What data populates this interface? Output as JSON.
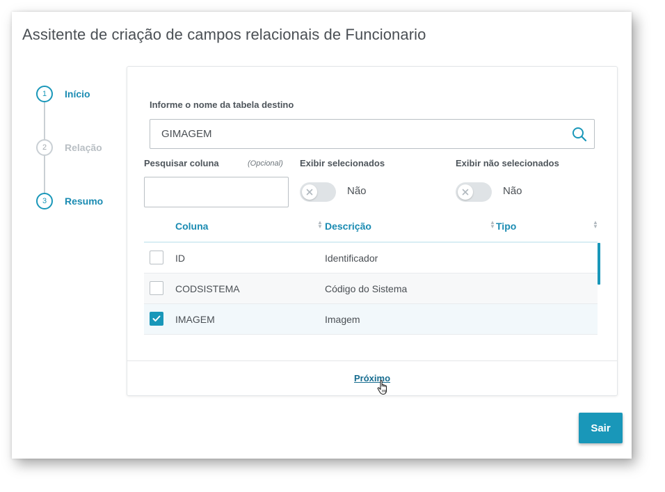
{
  "dialog": {
    "title": "Assitente de criação de campos relacionais de Funcionario"
  },
  "stepper": {
    "steps": [
      {
        "number": "1",
        "label": "Início",
        "active": true
      },
      {
        "number": "2",
        "label": "Relação",
        "active": false
      },
      {
        "number": "3",
        "label": "Resumo",
        "active": true
      }
    ]
  },
  "form": {
    "table_label": "Informe o nome da tabela destino",
    "table_value": "GIMAGEM",
    "column_search_label": "Pesquisar coluna",
    "column_search_optional": "(Opcional)",
    "column_search_value": "",
    "show_selected_label": "Exibir selecionados",
    "show_selected_value": "Não",
    "show_unselected_label": "Exibir não selecionados",
    "show_unselected_value": "Não"
  },
  "grid": {
    "headers": {
      "column": "Coluna",
      "description": "Descrição",
      "type": "Tipo"
    },
    "rows": [
      {
        "coluna": "ID",
        "descricao": "Identificador",
        "tipo": "",
        "checked": false
      },
      {
        "coluna": "CODSISTEMA",
        "descricao": "Código do Sistema",
        "tipo": "",
        "checked": false
      },
      {
        "coluna": "IMAGEM",
        "descricao": "Imagem",
        "tipo": "",
        "checked": true
      }
    ]
  },
  "footer": {
    "next_label": "Próximo",
    "exit_label": "Sair"
  },
  "colors": {
    "accent": "#1997b9",
    "link": "#166c8f",
    "text": "#4a4f54"
  },
  "icons": {
    "search": "search-icon",
    "toggle_off": "close-icon",
    "checkbox": "check-icon",
    "cursor": "hand-pointer-icon"
  }
}
